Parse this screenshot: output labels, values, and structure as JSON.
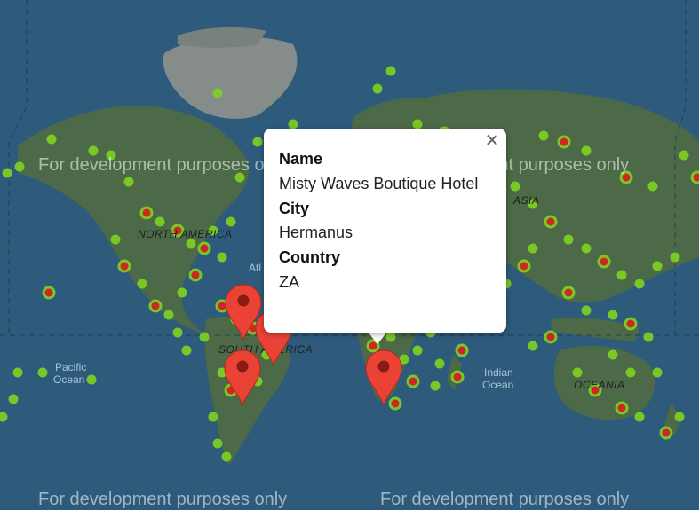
{
  "map": {
    "watermark": "For development purposes only",
    "continent_labels": [
      "NORTH AMERICA",
      "SOUTH AMERICA",
      "ASIA",
      "OCEANIA"
    ],
    "ocean_labels": {
      "pacific": [
        "Pacific",
        "Ocean"
      ],
      "atlantic": "Atl",
      "indian": [
        "Indian",
        "Ocean"
      ]
    },
    "colors": {
      "ocean": "#2d5a7b",
      "land": "#4a6a4a",
      "heat_low": "#7ed321",
      "heat_high": "#e02020",
      "marker": "#ea4335"
    }
  },
  "markers": [
    {
      "icon": "map-pin-icon",
      "location": "Venezuela"
    },
    {
      "icon": "map-pin-icon",
      "location": "Brazil east coast"
    },
    {
      "icon": "map-pin-icon",
      "location": "Argentina / Chile"
    },
    {
      "icon": "map-pin-icon",
      "location": "Hermanus, ZA"
    }
  ],
  "infowindow": {
    "name_label": "Name",
    "name_value": "Misty Waves Boutique Hotel",
    "city_label": "City",
    "city_value": "Hermanus",
    "country_label": "Country",
    "country_value": "ZA",
    "close_icon": "close-icon"
  }
}
